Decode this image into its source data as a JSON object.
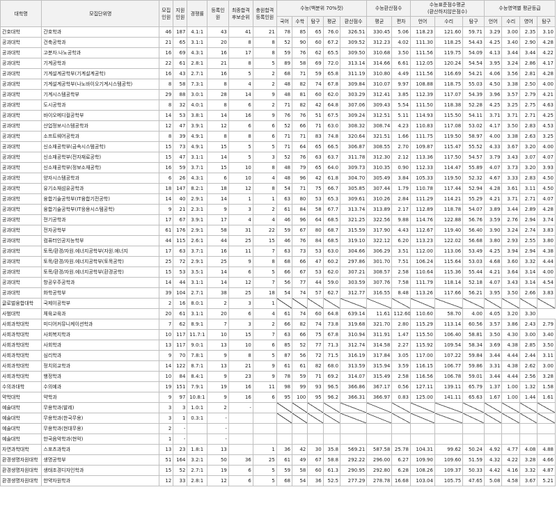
{
  "headers": {
    "college": "대학명",
    "major": "모집단위명",
    "quota": "모집\n인원",
    "applicants": "지원\n인원",
    "competition": "경쟁률",
    "registered": "등록인\n원",
    "final_rank": "최종합격\n후보순위",
    "additional": "충원합격\n등록인원",
    "pct_group": "수능(백분위 70%컷)",
    "conv_group": "수능환산점수",
    "std_group": "수능표준점수평균\n(환산하지않은점수)",
    "grade_group": "수능영역별 평균등급",
    "sub_pct": [
      "국어",
      "수학",
      "탐구",
      "평균",
      "환산점수"
    ],
    "sub_conv": [
      "평균",
      "편차"
    ],
    "sub_std": [
      "언어",
      "수리",
      "탐구"
    ],
    "sub_grade": [
      "언어",
      "수리",
      "영어",
      "탐구"
    ]
  },
  "rows": [
    [
      "간호대학",
      "간호학과",
      "46",
      "187",
      "4.1:1",
      "43",
      "41",
      "21",
      "78",
      "85",
      "65",
      "76.0",
      "326.51",
      "330.45",
      "5.06",
      "118.23",
      "121.60",
      "59.71",
      "3.29",
      "3.00",
      "2.35",
      "3.10"
    ],
    [
      "공과대학",
      "건축공학과",
      "21",
      "65",
      "3.1:1",
      "20",
      "8",
      "8",
      "52",
      "90",
      "60",
      "67.2",
      "309.52",
      "312.23",
      "4.02",
      "111.30",
      "118.25",
      "54.43",
      "4.25",
      "3.40",
      "2.90",
      "4.28"
    ],
    [
      "공과대학",
      "고분자.나노공학과",
      "16",
      "69",
      "4.3:1",
      "16",
      "17",
      "8",
      "59",
      "76",
      "62",
      "65.5",
      "309.50",
      "310.68",
      "3.50",
      "111.56",
      "119.75",
      "54.09",
      "4.13",
      "3.44",
      "3.44",
      "4.22"
    ],
    [
      "공과대학",
      "기계공학과",
      "22",
      "61",
      "2.8:1",
      "21",
      "8",
      "5",
      "89",
      "58",
      "69",
      "72.0",
      "313.14",
      "314.66",
      "6.61",
      "112.05",
      "120.24",
      "54.54",
      "3.95",
      "3.24",
      "2.86",
      "4.17"
    ],
    [
      "공과대학",
      "기계설계공학부(기계설계공학)",
      "16",
      "43",
      "2.7:1",
      "16",
      "5",
      "2",
      "68",
      "71",
      "59",
      "65.8",
      "311.19",
      "310.80",
      "4.49",
      "111.56",
      "116.69",
      "54.21",
      "4.06",
      "3.56",
      "2.81",
      "4.28"
    ],
    [
      "공과대학",
      "기계설계공학부(나노바이오기계시스템공학)",
      "8",
      "58",
      "7.3:1",
      "8",
      "4",
      "2",
      "48",
      "82",
      "74",
      "67.8",
      "309.84",
      "310.07",
      "9.97",
      "108.88",
      "118.75",
      "55.03",
      "4.50",
      "3.38",
      "2.50",
      "4.00"
    ],
    [
      "공과대학",
      "기계시스템공학부",
      "29",
      "88",
      "3.0:1",
      "28",
      "14",
      "9",
      "48",
      "81",
      "60",
      "62.0",
      "303.29",
      "312.41",
      "3.85",
      "112.39",
      "117.07",
      "54.39",
      "3.96",
      "3.57",
      "2.79",
      "4.21"
    ],
    [
      "공과대학",
      "도시공학과",
      "8",
      "32",
      "4.0:1",
      "8",
      "6",
      "2",
      "71",
      "82",
      "42",
      "64.8",
      "307.06",
      "309.43",
      "5.54",
      "111.50",
      "118.38",
      "52.28",
      "4.25",
      "3.25",
      "2.75",
      "4.63"
    ],
    [
      "공과대학",
      "바이오메디컬공학부",
      "14",
      "53",
      "3.8:1",
      "14",
      "16",
      "9",
      "76",
      "76",
      "51",
      "67.5",
      "309.24",
      "312.51",
      "5.11",
      "114.93",
      "115.50",
      "54.11",
      "3.71",
      "3.71",
      "2.71",
      "4.25"
    ],
    [
      "공과대학",
      "산업정보시스템공학과",
      "12",
      "47",
      "3.9:1",
      "12",
      "6",
      "6",
      "52",
      "66",
      "71",
      "63.0",
      "308.32",
      "308.74",
      "4.23",
      "110.83",
      "117.08",
      "53.02",
      "4.17",
      "3.50",
      "2.83",
      "4.53"
    ],
    [
      "공과대학",
      "소프트웨어공학과",
      "8",
      "39",
      "4.9:1",
      "8",
      "8",
      "6",
      "71",
      "71",
      "83",
      "74.8",
      "320.64",
      "321.51",
      "1.66",
      "111.75",
      "119.50",
      "58.97",
      "4.00",
      "3.38",
      "2.63",
      "3.25"
    ],
    [
      "공과대학",
      "신소재공학부(금속시스템공학)",
      "15",
      "73",
      "4.9:1",
      "15",
      "5",
      "5",
      "71",
      "64",
      "65",
      "66.5",
      "306.87",
      "308.55",
      "2.70",
      "109.87",
      "115.47",
      "55.52",
      "4.33",
      "3.67",
      "3.20",
      "4.00"
    ],
    [
      "공과대학",
      "신소재공학부(전자재료공학)",
      "15",
      "47",
      "3.1:1",
      "14",
      "5",
      "3",
      "52",
      "76",
      "63",
      "63.7",
      "311.78",
      "312.30",
      "2.12",
      "113.36",
      "117.50",
      "54.57",
      "3.79",
      "3.43",
      "3.07",
      "4.07"
    ],
    [
      "공과대학",
      "신소재공학부(정보소재공학)",
      "16",
      "59",
      "3.7:1",
      "15",
      "10",
      "8",
      "48",
      "79",
      "65",
      "64.0",
      "309.73",
      "310.35",
      "0.90",
      "112.33",
      "114.47",
      "55.89",
      "4.07",
      "3.73",
      "3.20",
      "3.93"
    ],
    [
      "공과대학",
      "양자시스템공학과",
      "6",
      "26",
      "4.3:1",
      "6",
      "10",
      "4",
      "48",
      "96",
      "42",
      "61.8",
      "304.70",
      "305.49",
      "3.84",
      "105.33",
      "119.50",
      "52.32",
      "4.67",
      "3.33",
      "2.83",
      "4.50"
    ],
    [
      "공과대학",
      "유기소재섬유공학과",
      "18",
      "147",
      "8.2:1",
      "18",
      "12",
      "8",
      "54",
      "71",
      "75",
      "66.7",
      "305.85",
      "307.44",
      "1.79",
      "110.78",
      "117.44",
      "52.94",
      "4.28",
      "3.61",
      "3.11",
      "4.50"
    ],
    [
      "공과대학",
      "융합기술공학부(IT융합기전공학)",
      "14",
      "40",
      "2.9:1",
      "14",
      "1",
      "1",
      "63",
      "80",
      "53",
      "65.3",
      "309.61",
      "310.26",
      "2.84",
      "111.29",
      "114.21",
      "55.29",
      "4.21",
      "3.71",
      "2.71",
      "4.07"
    ],
    [
      "공과대학",
      "융합기술공학부(IT응용시스템공학)",
      "9",
      "21",
      "2.3:1",
      "9",
      "3",
      "2",
      "61",
      "84",
      "58",
      "67.7",
      "313.74",
      "313.89",
      "2.17",
      "112.89",
      "118.78",
      "54.07",
      "3.89",
      "3.44",
      "2.89",
      "4.28"
    ],
    [
      "공과대학",
      "전기공학과",
      "17",
      "67",
      "3.9:1",
      "17",
      "4",
      "4",
      "46",
      "96",
      "64",
      "68.5",
      "321.25",
      "322.56",
      "9.88",
      "114.76",
      "122.88",
      "56.76",
      "3.59",
      "2.76",
      "2.94",
      "3.74"
    ],
    [
      "공과대학",
      "전자공학부",
      "61",
      "176",
      "2.9:1",
      "58",
      "31",
      "22",
      "59",
      "67",
      "80",
      "68.7",
      "315.59",
      "317.90",
      "4.43",
      "112.67",
      "119.40",
      "56.40",
      "3.90",
      "3.24",
      "2.74",
      "3.83"
    ],
    [
      "공과대학",
      "컴퓨터인공지능학부",
      "44",
      "115",
      "2.6:1",
      "44",
      "25",
      "15",
      "46",
      "76",
      "84",
      "68.5",
      "319.10",
      "322.12",
      "6.20",
      "113.23",
      "122.02",
      "56.68",
      "3.80",
      "2.93",
      "2.55",
      "3.80"
    ],
    [
      "공과대학",
      "토목/환경/자원.에너지공학부(자원.에너지",
      "17",
      "63",
      "3.7:1",
      "16",
      "11",
      "7",
      "63",
      "73",
      "53",
      "63.0",
      "304.66",
      "306.29",
      "3.51",
      "112.00",
      "113.06",
      "53.49",
      "4.25",
      "3.94",
      "2.94",
      "4.38"
    ],
    [
      "공과대학",
      "토목/환경/자원.에너지공학부(토목공학)",
      "25",
      "72",
      "2.9:1",
      "25",
      "9",
      "8",
      "68",
      "66",
      "47",
      "60.2",
      "297.86",
      "301.70",
      "7.51",
      "106.24",
      "115.64",
      "53.03",
      "4.68",
      "3.60",
      "3.32",
      "4.44"
    ],
    [
      "공과대학",
      "토목/환경/자원.에너지공학부(환경공학)",
      "15",
      "53",
      "3.5:1",
      "14",
      "6",
      "5",
      "66",
      "67",
      "53",
      "62.0",
      "307.21",
      "308.57",
      "2.58",
      "110.64",
      "115.36",
      "55.44",
      "4.21",
      "3.64",
      "3.14",
      "4.00"
    ],
    [
      "공과대학",
      "항공우주공학과",
      "14",
      "44",
      "3.1:1",
      "14",
      "12",
      "7",
      "56",
      "77",
      "44",
      "59.0",
      "303.59",
      "307.76",
      "7.58",
      "111.79",
      "118.14",
      "52.18",
      "4.07",
      "3.43",
      "3.14",
      "4.54"
    ],
    [
      "공과대학",
      "화학공학부",
      "39",
      "104",
      "2.7:1",
      "38",
      "25",
      "18",
      "54",
      "74",
      "57",
      "62.7",
      "312.77",
      "316.55",
      "8.48",
      "113.26",
      "117.66",
      "56.21",
      "3.95",
      "3.50",
      "2.66",
      "3.83"
    ],
    [
      "글로벌융합대학",
      "국제이공학부",
      "2",
      "16",
      "8.0:1",
      "2",
      "3",
      "1",
      "",
      "",
      "",
      "",
      "",
      "",
      "",
      "",
      "",
      "",
      "",
      "",
      "",
      ""
    ],
    [
      "사범대학",
      "체육교육과",
      "20",
      "61",
      "3.1:1",
      "20",
      "6",
      "4",
      "61",
      "74",
      "60",
      "64.8",
      "639.14",
      "11.61",
      "112.60",
      "110.60",
      "58.70",
      "4.00",
      "4.05",
      "3.20",
      "3.30"
    ],
    [
      "사회과학대학",
      "미디어커뮤니케이션학과",
      "7",
      "62",
      "8.9:1",
      "7",
      "3",
      "2",
      "66",
      "82",
      "74",
      "73.8",
      "319.68",
      "321.70",
      "2.80",
      "115.29",
      "113.14",
      "60.56",
      "3.57",
      "3.86",
      "2.43",
      "2.79"
    ],
    [
      "사회과학대학",
      "사회복지학과",
      "10",
      "117",
      "11.7:1",
      "10",
      "15",
      "7",
      "63",
      "66",
      "75",
      "67.8",
      "310.94",
      "311.91",
      "1.47",
      "115.50",
      "106.40",
      "58.81",
      "3.50",
      "4.30",
      "3.00",
      "3.40"
    ],
    [
      "사회과학대학",
      "사회학과",
      "13",
      "117",
      "9.0:1",
      "13",
      "10",
      "6",
      "85",
      "52",
      "77",
      "71.3",
      "312.74",
      "314.58",
      "2.27",
      "115.92",
      "109.54",
      "58.34",
      "3.69",
      "4.38",
      "2.85",
      "3.50"
    ],
    [
      "사회과학대학",
      "심리학과",
      "9",
      "70",
      "7.8:1",
      "9",
      "8",
      "5",
      "87",
      "56",
      "72",
      "71.5",
      "316.19",
      "317.84",
      "3.05",
      "117.00",
      "107.22",
      "59.84",
      "3.44",
      "4.44",
      "2.44",
      "3.11"
    ],
    [
      "사회과학대학",
      "정치외교학과",
      "14",
      "122",
      "8.7:1",
      "13",
      "21",
      "9",
      "61",
      "61",
      "82",
      "68.0",
      "313.59",
      "315.94",
      "3.59",
      "116.15",
      "106.77",
      "59.86",
      "3.31",
      "4.38",
      "2.62",
      "3.00"
    ],
    [
      "사회과학대학",
      "행정학과",
      "10",
      "84",
      "8.4:1",
      "9",
      "23",
      "9",
      "78",
      "59",
      "71",
      "69.2",
      "314.07",
      "315.49",
      "2.58",
      "116.56",
      "106.78",
      "59.01",
      "3.44",
      "4.44",
      "2.56",
      "3.28"
    ],
    [
      "수의과대학",
      "수의예과",
      "19",
      "151",
      "7.9:1",
      "19",
      "16",
      "11",
      "98",
      "99",
      "93",
      "96.5",
      "366.86",
      "367.17",
      "0.56",
      "127.11",
      "139.11",
      "65.79",
      "1.37",
      "1.00",
      "1.32",
      "1.58"
    ],
    [
      "약학대학",
      "약학과",
      "9",
      "97",
      "10.8:1",
      "9",
      "16",
      "6",
      "95",
      "100",
      "95",
      "96.2",
      "366.31",
      "366.97",
      "0.83",
      "125.00",
      "141.11",
      "65.63",
      "1.67",
      "1.00",
      "1.44",
      "1.61"
    ],
    [
      "예술대학",
      "무용학과(발레)",
      "3",
      "3",
      "1.0:1",
      "2",
      "-",
      "",
      "",
      "",
      "",
      "",
      "",
      "",
      "",
      "",
      "",
      "",
      "",
      "",
      "",
      ""
    ],
    [
      "예술대학",
      "무용학과(한국무용)",
      "3",
      "1",
      "0.3:1",
      "-",
      "",
      "",
      "",
      "",
      "",
      "",
      "",
      "",
      "",
      "",
      "",
      "",
      "",
      "",
      "",
      ""
    ],
    [
      "예술대학",
      "무용학과(현대무용)",
      "2",
      "-",
      "",
      "-",
      "",
      "",
      "",
      "",
      "",
      "",
      "",
      "",
      "",
      "",
      "",
      "",
      "",
      "",
      "",
      ""
    ],
    [
      "예술대학",
      "한국음악학과(현악)",
      "1",
      "-",
      "",
      "-",
      "",
      "",
      "",
      "",
      "",
      "",
      "",
      "",
      "",
      "",
      "",
      "",
      "",
      "",
      "",
      ""
    ],
    [
      "자연과학대학",
      "스포츠과학과",
      "13",
      "23",
      "1.8:1",
      "13",
      "",
      "1",
      "36",
      "42",
      "30",
      "35.8",
      "569.21",
      "587.58",
      "25.78",
      "104.31",
      "99.62",
      "50.24",
      "4.92",
      "4.77",
      "4.08",
      "4.88"
    ],
    [
      "환경생명자원대학",
      "생명공학부",
      "51",
      "164",
      "3.2:1",
      "50",
      "36",
      "25",
      "61",
      "49",
      "67",
      "58.8",
      "292.22",
      "296.00",
      "6.27",
      "109.90",
      "109.60",
      "51.59",
      "4.32",
      "4.22",
      "3.28",
      "4.66"
    ],
    [
      "환경생명자원대학",
      "생태조경디자인학과",
      "15",
      "52",
      "2.7:1",
      "19",
      "6",
      "5",
      "59",
      "58",
      "60",
      "61.3",
      "290.95",
      "292.80",
      "6.28",
      "108.26",
      "109.37",
      "50.33",
      "4.42",
      "4.16",
      "3.32",
      "4.87"
    ],
    [
      "환경생명자원대학",
      "한약자원학과",
      "12",
      "33",
      "2.8:1",
      "12",
      "6",
      "5",
      "68",
      "54",
      "36",
      "52.5",
      "277.29",
      "278.78",
      "16.68",
      "103.04",
      "105.75",
      "47.65",
      "5.08",
      "4.58",
      "3.67",
      "5.21"
    ]
  ]
}
